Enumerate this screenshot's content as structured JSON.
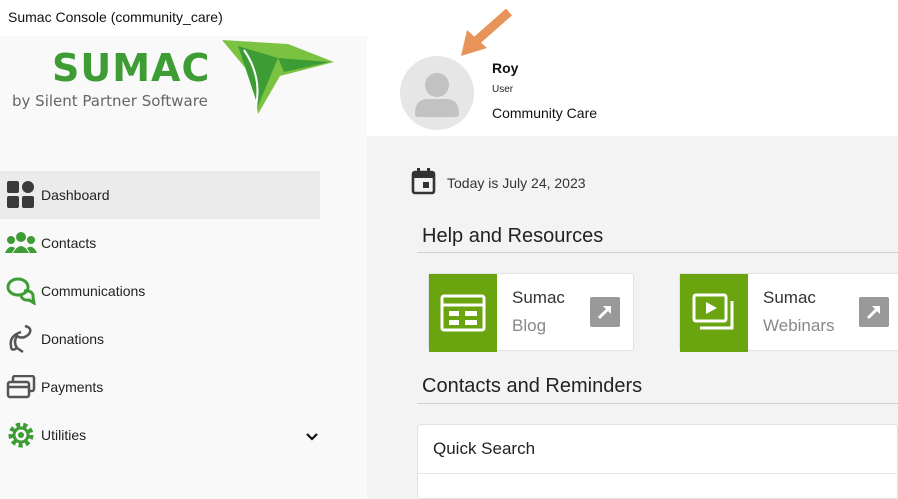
{
  "window": {
    "title": "Sumac Console (community_care)"
  },
  "logo": {
    "word": "SUMAC",
    "tagline": "by Silent Partner Software"
  },
  "sidebar": {
    "items": [
      {
        "label": "Dashboard",
        "icon": "dashboard-icon",
        "active": true
      },
      {
        "label": "Contacts",
        "icon": "people-icon"
      },
      {
        "label": "Communications",
        "icon": "chat-icon"
      },
      {
        "label": "Donations",
        "icon": "donation-icon"
      },
      {
        "label": "Payments",
        "icon": "payments-icon"
      },
      {
        "label": "Utilities",
        "icon": "gear-icon",
        "expandable": true
      }
    ]
  },
  "profile": {
    "name": "Roy",
    "role": "User",
    "organization": "Community Care"
  },
  "dashboard": {
    "today": "Today is July 24, 2023",
    "help_title": "Help and Resources",
    "resources": [
      {
        "title": "Sumac",
        "subtitle": "Blog",
        "icon": "blog-icon"
      },
      {
        "title": "Sumac",
        "subtitle": "Webinars",
        "icon": "video-icon"
      }
    ],
    "contacts_title": "Contacts and Reminders",
    "quick_search_title": "Quick Search"
  },
  "colors": {
    "brand_green": "#3e9c35",
    "tile_green": "#6aa40f",
    "arrow_orange": "#e8935a"
  }
}
